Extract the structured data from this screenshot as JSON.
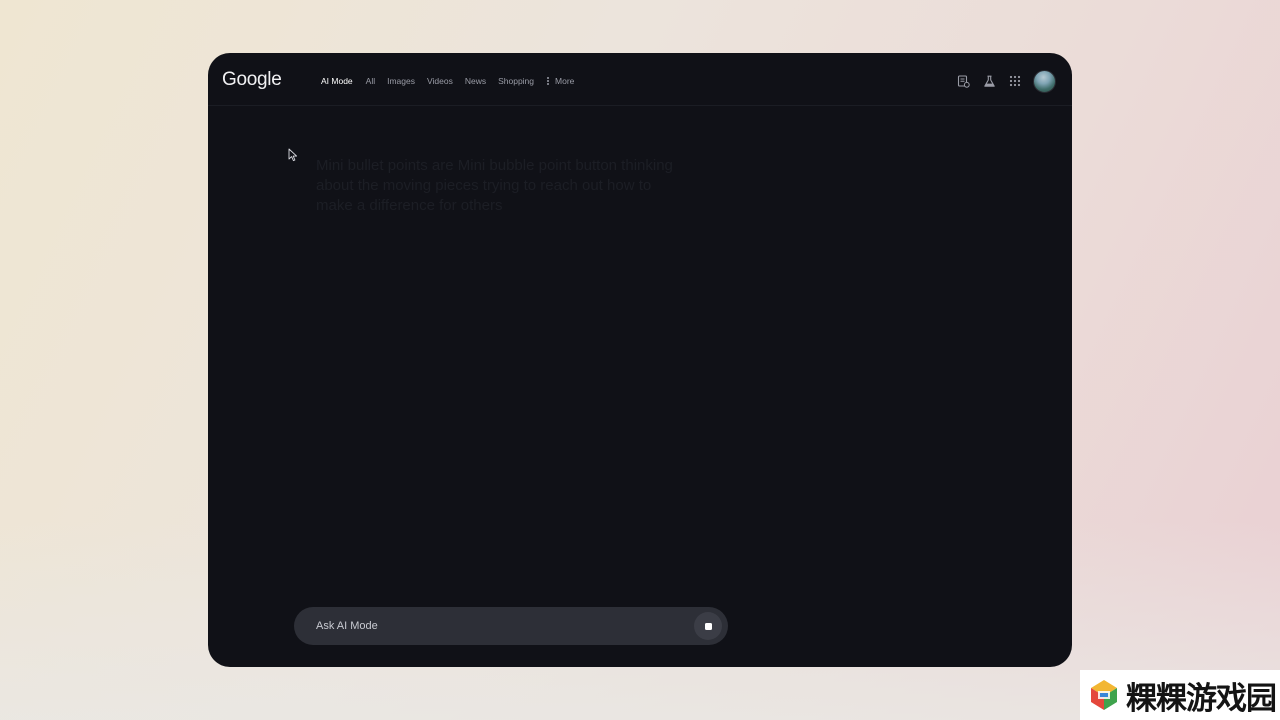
{
  "brand": {
    "logo_text": "Google"
  },
  "nav": {
    "tabs": [
      {
        "label": "AI Mode",
        "active": true
      },
      {
        "label": "All",
        "active": false
      },
      {
        "label": "Images",
        "active": false
      },
      {
        "label": "Videos",
        "active": false
      },
      {
        "label": "News",
        "active": false
      },
      {
        "label": "Shopping",
        "active": false
      }
    ],
    "more_label": "More"
  },
  "header_icons": [
    "search-history-icon",
    "labs-flask-icon",
    "apps-grid-icon",
    "profile-avatar"
  ],
  "response": {
    "text": "Mini bullet points are Mini bubble point button thinking about the moving pieces trying to reach out how to make a difference for others"
  },
  "ask_bar": {
    "placeholder": "Ask AI Mode",
    "action": "stop-icon"
  },
  "watermark": {
    "text": "粿粿游戏园"
  },
  "colors": {
    "window_bg": "#101117",
    "ask_bar_bg": "#2d2f37",
    "active_tab": "#ffffff",
    "inactive_tab": "#9a9ca6"
  }
}
